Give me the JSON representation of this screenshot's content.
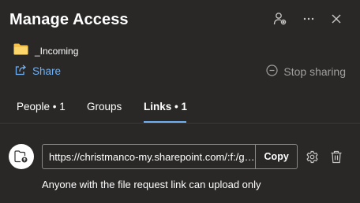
{
  "header": {
    "title": "Manage Access",
    "icons": [
      "person-settings-icon",
      "more-icon",
      "close-icon"
    ]
  },
  "item": {
    "name": "_Incoming",
    "icon": "folder-icon",
    "icon_color": "#f8c24a"
  },
  "actions": {
    "share_label": "Share",
    "share_icon": "share-arrow-icon",
    "stop_sharing_label": "Stop sharing",
    "stop_sharing_icon": "circle-minus-icon"
  },
  "tabs": [
    {
      "label": "People • 1",
      "active": false
    },
    {
      "label": "Groups",
      "active": false
    },
    {
      "label": "Links • 1",
      "active": true
    }
  ],
  "link": {
    "icon": "folder-upload-icon",
    "url": "https://christmanco-my.sharepoint.com/:f:/g/personal",
    "copy_label": "Copy",
    "row_icons": [
      "gear-icon",
      "trash-icon"
    ],
    "description": "Anyone with the file request link can upload only"
  },
  "colors": {
    "background": "#292827",
    "accent": "#6fb0f5",
    "muted_text": "#a19f9d",
    "border": "#8a8886"
  }
}
